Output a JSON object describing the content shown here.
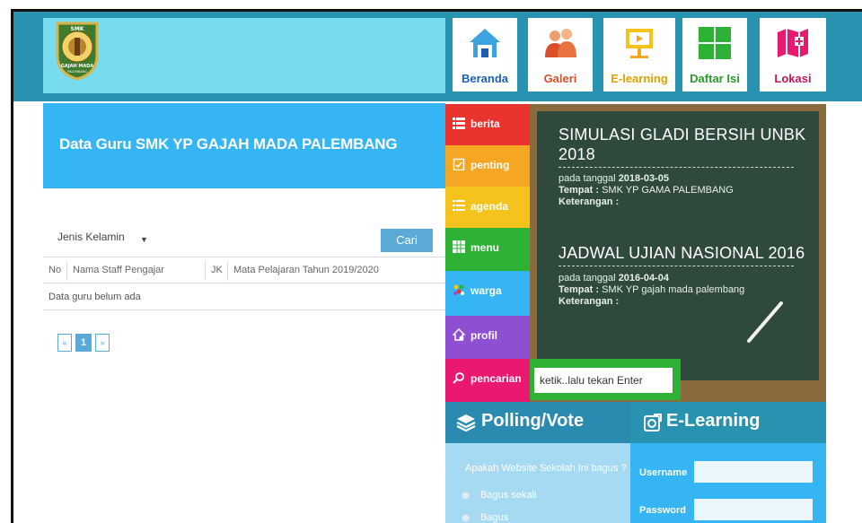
{
  "header": {
    "logo_icon": "school-crest-logo",
    "logo_lines": [
      "SMK",
      "GAJAH MADA",
      "PALEMBANG"
    ],
    "nav": [
      {
        "label": "Beranda",
        "icon": "home-icon",
        "color": "#1a5fb4"
      },
      {
        "label": "Galeri",
        "icon": "people-icon",
        "color": "#d94f2a"
      },
      {
        "label": "E-learning",
        "icon": "presentation-icon",
        "color": "#e0a100"
      },
      {
        "label": "Daftar Isi",
        "icon": "grid-icon",
        "color": "#2b9a2b"
      },
      {
        "label": "Lokasi",
        "icon": "map-icon",
        "color": "#c2185b"
      }
    ]
  },
  "main": {
    "title": "Data Guru SMK YP GAJAH MADA PALEMBANG",
    "filter_label": "Jenis Kelamin",
    "search_button": "Cari",
    "table_headers": [
      "No",
      "Nama Staff Pengajar",
      "JK",
      "Mata Pelajaran Tahun 2019/2020"
    ],
    "empty_message": "Data guru belum ada",
    "pager": {
      "prev": "«",
      "current": "1",
      "next": "»"
    }
  },
  "sidemenu": [
    {
      "label": "berita",
      "color": "#e8332e",
      "icon": "news-icon"
    },
    {
      "label": "penting",
      "color": "#f5a623",
      "icon": "clipboard-icon"
    },
    {
      "label": "agenda",
      "color": "#f5c31c",
      "icon": "list-icon"
    },
    {
      "label": "menu",
      "color": "#2db236",
      "icon": "grid-menu-icon"
    },
    {
      "label": "warga",
      "color": "#35b5f3",
      "icon": "group-icon"
    },
    {
      "label": "profil",
      "color": "#8e4fd3",
      "icon": "house-profile-icon"
    },
    {
      "label": "pencarian",
      "color": "#e8196e",
      "icon": "search-icon"
    }
  ],
  "board": {
    "events": [
      {
        "title_line1": "SIMULASI GLADI BERSIH UNBK",
        "title_line2": "2018",
        "date_label": "pada tanggal",
        "date": "2018-03-05",
        "place_label": "Tempat :",
        "place": "SMK YP GAMA PALEMBANG",
        "note_label": "Keterangan :"
      },
      {
        "title_line1": "JADWAL UJIAN NASIONAL 2016",
        "title_line2": "",
        "date_label": "pada tanggal",
        "date": "2016-04-04",
        "place_label": "Tempat :",
        "place": "SMK YP gajah mada palembang",
        "note_label": "Keterangan :"
      }
    ]
  },
  "search": {
    "placeholder": "ketik..lalu tekan Enter"
  },
  "poll": {
    "heading": "Polling/Vote",
    "question": "Apakah Website Sekolah Ini bagus ?",
    "options": [
      "Bagus sekali",
      "Bagus"
    ]
  },
  "elearning": {
    "heading": "E-Learning",
    "username_label": "Username",
    "password_label": "Password"
  }
}
